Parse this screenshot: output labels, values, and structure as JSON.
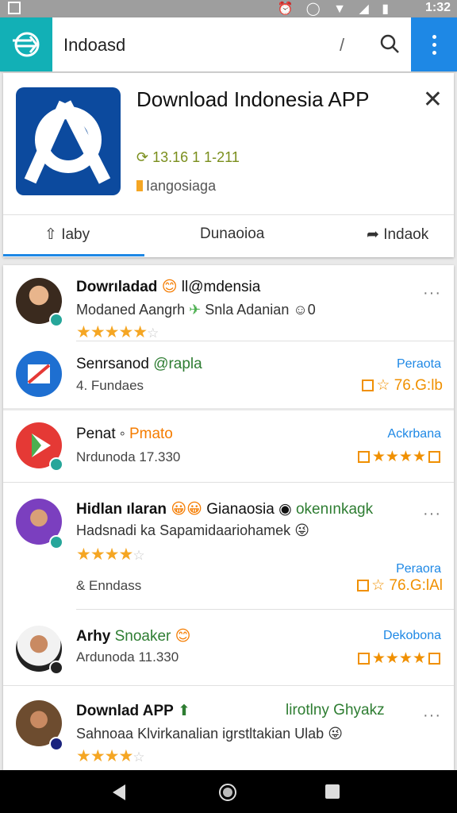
{
  "status_bar": {
    "time": "1:32",
    "icons": "⏰ ◯ ▼ ◢ ▮"
  },
  "search": {
    "value": "Indoasd",
    "clear_glyph": "/"
  },
  "app": {
    "title": "Download Indonesia APP",
    "rating": "13.16 1 1-211",
    "language": "Iangosiaga",
    "tabs": [
      {
        "label": "Iaby"
      },
      {
        "label": "Dunaoioa"
      },
      {
        "label": "Indaok"
      }
    ],
    "close": "✕"
  },
  "list": [
    {
      "title": "Dowrıladad",
      "title_extra": "ll@mdensia",
      "subtitle": "Modaned Aangrh",
      "subtitle_extra": "Snla Adanian",
      "subtitle_num": "0",
      "rating_text": "4.5",
      "more": "···"
    },
    {
      "title": "Senrsanod",
      "title_extra": "@rapla",
      "meta": "4. Fundaes",
      "tag": "Peraota",
      "price": "☆ 76.G:lb"
    },
    {
      "title": "Penat",
      "title_extra": "Pmato",
      "meta": "Nrdunoda 17.330",
      "tag": "Ackrbana",
      "price": "★★★★"
    },
    {
      "title": "Hidlan ılaran",
      "title_extra": "Gianaosia",
      "title_extra2": "okenınkagk",
      "subtitle": "Hadsnadi ka Sapamidaariohamek",
      "meta": "& Enndass",
      "tag": "Peraora",
      "price": "☆ 76.G:lAl",
      "more": "···"
    },
    {
      "title": "Arhy",
      "title_extra": "Snoaker",
      "meta": "Ardunoda 11.330",
      "tag": "Dekobona",
      "price": "★★★★"
    },
    {
      "title": "Downlad APP",
      "title_extra": "lirotlny Ghyakz",
      "subtitle": "Sahnoaa Klvirkanalian igrstltakian Ulab",
      "more": "···"
    }
  ],
  "colors": {
    "accent": "#1e88e5",
    "logo_bg": "#12b0b6",
    "star": "#f5a623",
    "price": "#f09000",
    "green": "#2e7d32"
  }
}
